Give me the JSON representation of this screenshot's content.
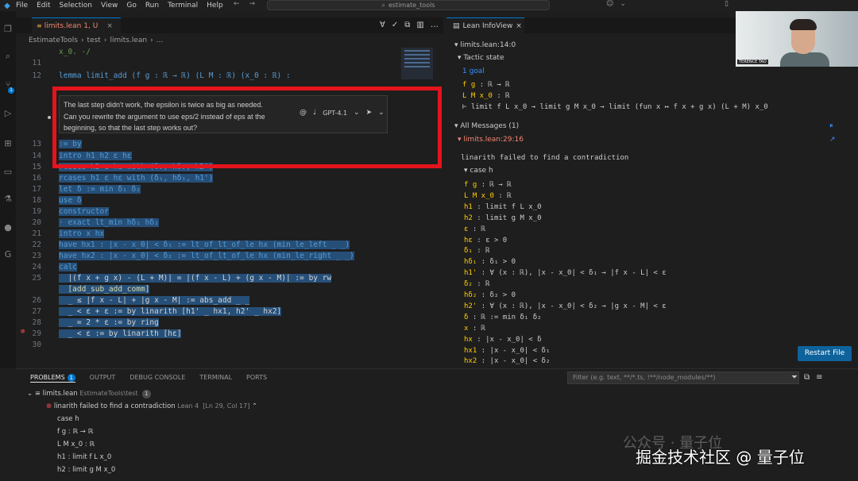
{
  "titlebar": {
    "menu": [
      "File",
      "Edit",
      "Selection",
      "View",
      "Go",
      "Run",
      "Terminal",
      "Help"
    ],
    "search": "estimate_tools"
  },
  "editor": {
    "tab_label": "limits.lean",
    "tab_status": "1, U",
    "breadcrumb": [
      "EstimateTools",
      "test",
      "limits.lean",
      "..."
    ],
    "lines": [
      {
        "n": "",
        "text": "x_0. -/"
      },
      {
        "n": "11",
        "text": ""
      },
      {
        "n": "12",
        "text": "lemma limit_add (f g : ℝ → ℝ) (L M : ℝ) (x_0 : ℝ) :"
      },
      {
        "n": "13",
        "text": ":= by"
      },
      {
        "n": "14",
        "text": "intro h1 h2 ε hε"
      },
      {
        "n": "15",
        "text": "rcases h2 ε hε with (δ₂, hδ₂, h2')"
      },
      {
        "n": "16",
        "text": "rcases h1 ε hε with (δ₁, hδ₁, h1')"
      },
      {
        "n": "17",
        "text": "let δ := min δ₁ δ₂"
      },
      {
        "n": "18",
        "text": "use δ"
      },
      {
        "n": "19",
        "text": "constructor"
      },
      {
        "n": "20",
        "text": "· exact lt_min hδ₁ hδ₂"
      },
      {
        "n": "21",
        "text": "intro x hx"
      },
      {
        "n": "22",
        "text": "have hx1 : |x - x_0| < δ₁ := lt_of_lt_of_le hx (min_le_left _ _)"
      },
      {
        "n": "23",
        "text": "have hx2 : |x - x_0| < δ₂ := lt_of_lt_of_le hx (min_le_right _ _)"
      },
      {
        "n": "24",
        "text": "calc"
      },
      {
        "n": "25",
        "text": "  |(f x + g x) - (L + M)| = |(f x - L) + (g x - M)| := by rw"
      },
      {
        "n": "",
        "text": "  [add_sub_add_comm]"
      },
      {
        "n": "26",
        "text": "  _ ≤ |f x - L| + |g x - M| := abs_add _ _"
      },
      {
        "n": "27",
        "text": "  _ < ε + ε := by linarith [h1' _ hx1, h2' _ hx2]"
      },
      {
        "n": "28",
        "text": "  _ = 2 * ε := by ring"
      },
      {
        "n": "29",
        "text": "  _ < ε := by linarith [hε]"
      },
      {
        "n": "30",
        "text": ""
      }
    ]
  },
  "chat": {
    "message_line1": "The last step didn't work, the epsilon is twice as big as needed.",
    "message_line2": "Can you rewrite the argument to use eps/2 instead of eps at the",
    "message_line3": "beginning, so that the last step works out?",
    "model": "GPT-4.1"
  },
  "infoview": {
    "tab_label": "Lean InfoView",
    "file_pos": "limits.lean:14:0",
    "tactic_state": "Tactic state",
    "goal_count": "1 goal",
    "goal_hyps": [
      {
        "name": "f g",
        "type": ": ℝ → ℝ"
      },
      {
        "name": "L M x_0",
        "type": ": ℝ"
      }
    ],
    "goal_target": "⊢ limit f L x_0 → limit g M x_0 → limit (fun x ↦ f x + g x) (L + M) x_0",
    "all_messages": "All Messages (1)",
    "msg_loc": "limits.lean:29:16",
    "msg_text": "linarith failed to find a contradiction",
    "case_label": "case h",
    "case_hyps": [
      {
        "name": "f g",
        "type": ": ℝ → ℝ"
      },
      {
        "name": "L M x_0",
        "type": ": ℝ"
      },
      {
        "name": "h1",
        "type": ": limit f L x_0"
      },
      {
        "name": "h2",
        "type": ": limit g M x_0"
      },
      {
        "name": "ε",
        "type": ": ℝ"
      },
      {
        "name": "hε",
        "type": ": ε > 0"
      },
      {
        "name": "δ₁",
        "type": ": ℝ"
      },
      {
        "name": "hδ₁",
        "type": ": δ₁ > 0"
      },
      {
        "name": "h1'",
        "type": ": ∀ (x : ℝ), |x - x_0| < δ₁ → |f x - L| < ε"
      },
      {
        "name": "δ₂",
        "type": ": ℝ"
      },
      {
        "name": "hδ₂",
        "type": ": δ₂ > 0"
      },
      {
        "name": "h2'",
        "type": ": ∀ (x : ℝ), |x - x_0| < δ₂ → |g x - M| < ε"
      },
      {
        "name": "δ",
        "type": ": ℝ := min δ₁ δ₂"
      },
      {
        "name": "x",
        "type": ": ℝ"
      },
      {
        "name": "hx",
        "type": ": |x - x_0| < δ"
      },
      {
        "name": "hx1",
        "type": ": |x - x_0| < δ₁"
      },
      {
        "name": "hx2",
        "type": ": |x - x_0| < δ₂"
      }
    ],
    "restart_button": "Restart File"
  },
  "webcam": {
    "name_tag": "TERENCE TAO"
  },
  "panel": {
    "tabs": [
      "PROBLEMS",
      "OUTPUT",
      "DEBUG CONSOLE",
      "TERMINAL",
      "PORTS"
    ],
    "problems_count": "1",
    "filter_placeholder": "Filter (e.g. text, **/*.ts, !**/node_modules/**)",
    "file_name": "limits.lean",
    "file_path": "EstimateTools\\test",
    "file_count": "1",
    "error_msg": "linarith failed to find a contradiction",
    "error_meta": "Lean 4  [Ln 29, Col 17]",
    "detail_lines": [
      "case h",
      "f g : ℝ → ℝ",
      "L M x_0 : ℝ",
      "h1 : limit f L x_0",
      "h2 : limit g M x_0"
    ]
  },
  "watermark": {
    "line1": "公众号 · 量子位",
    "line2": "掘金技术社区 @ 量子位"
  }
}
